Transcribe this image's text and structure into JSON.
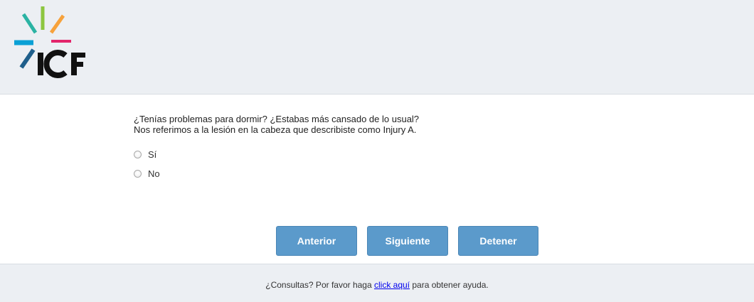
{
  "header": {
    "logo_text": "ICF",
    "logo_colors": [
      "#0aa0d5",
      "#2bb3a3",
      "#8dc63f",
      "#f7a23b",
      "#e2256b",
      "#1f5f8b"
    ]
  },
  "question": {
    "line1": "¿Tenías problemas para dormir? ¿Estabas más cansado de lo usual?",
    "line2": "Nos referimos a la lesión en la cabeza que describiste como Injury A."
  },
  "options": [
    {
      "label": "Sí",
      "selected": false
    },
    {
      "label": "No",
      "selected": false
    }
  ],
  "buttons": {
    "previous": "Anterior",
    "next": "Siguiente",
    "stop": "Detener",
    "color": "#5b9acb"
  },
  "footer": {
    "prefix": "¿Consultas? Por favor haga ",
    "link": "click aquí",
    "suffix": " para obtener ayuda."
  }
}
